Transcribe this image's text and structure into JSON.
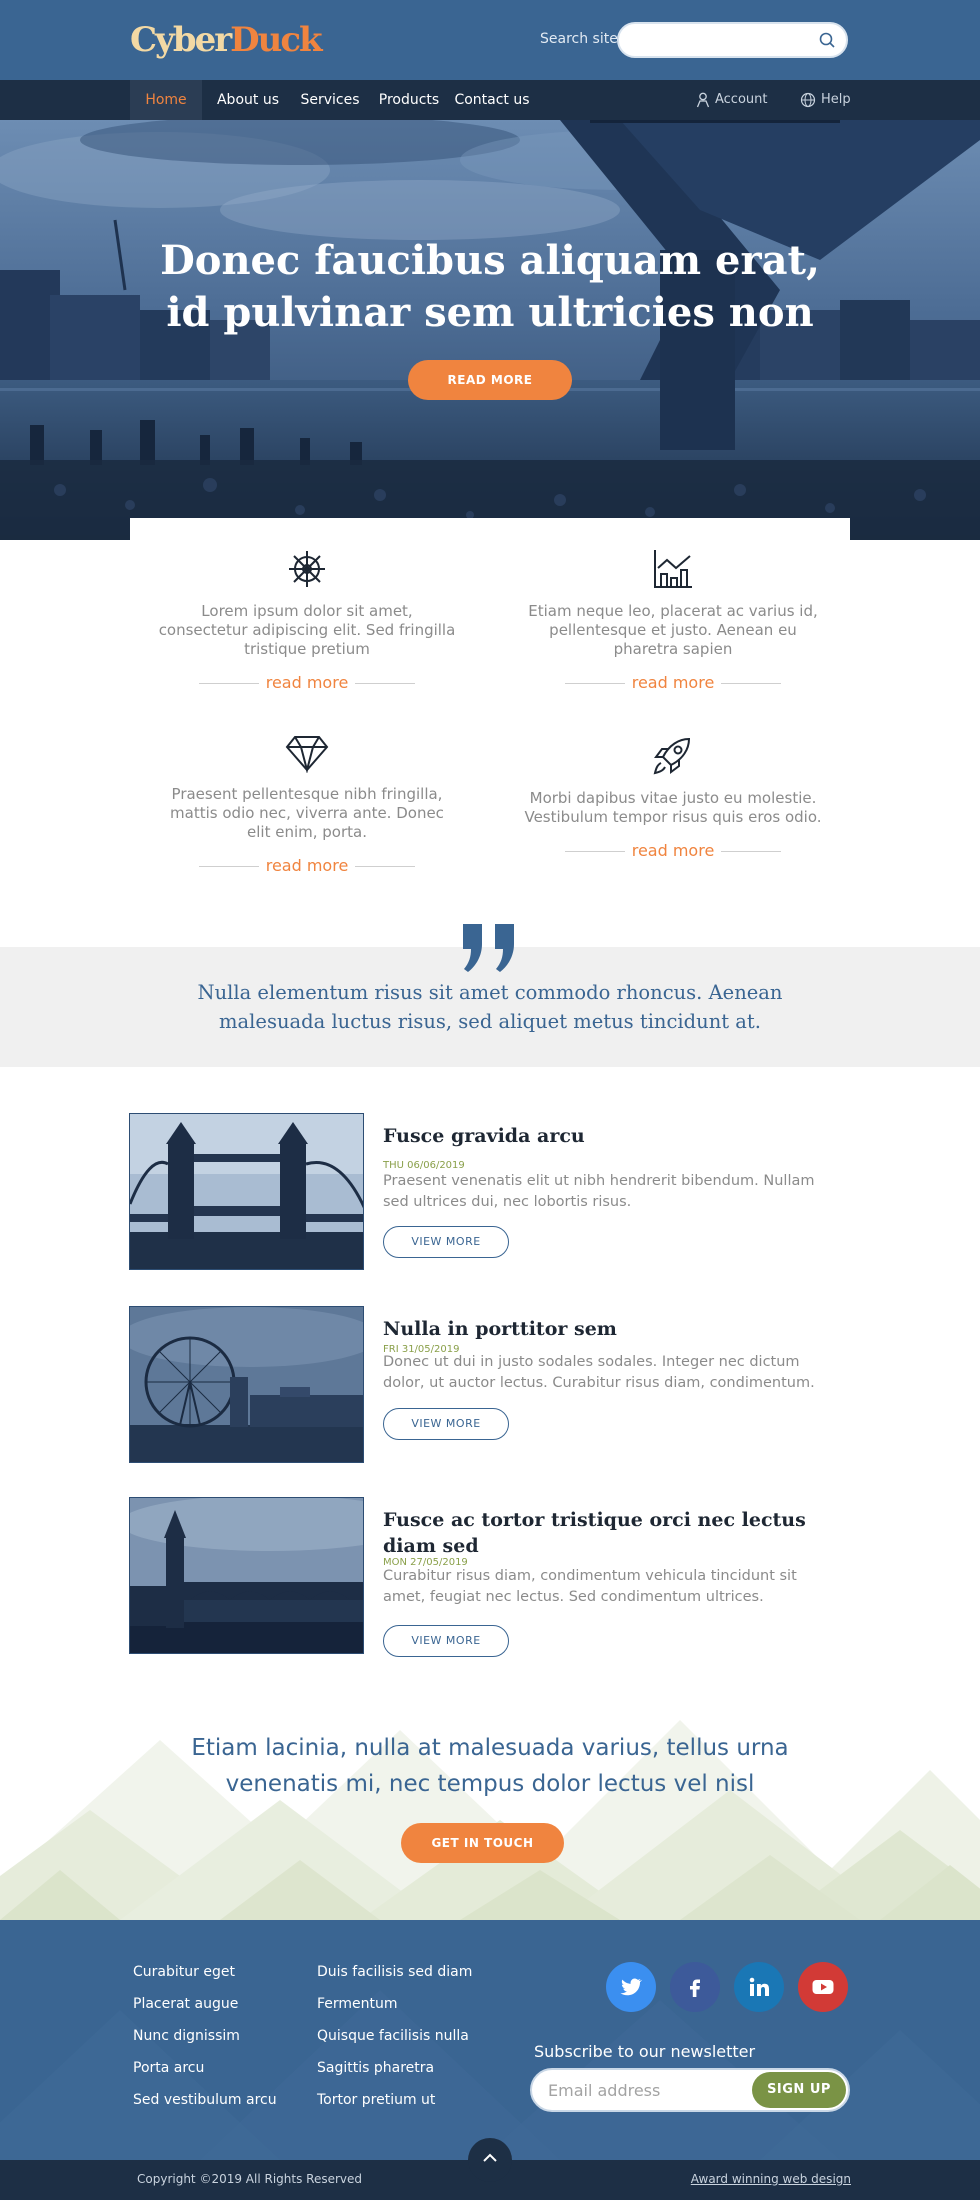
{
  "brand": {
    "logo_part1": "Cyber",
    "logo_part2": "Duck",
    "colors": {
      "primary": "#3a6592",
      "accent": "#f0843f",
      "dark": "#1d2f45",
      "green": "#7a9345"
    }
  },
  "search": {
    "label": "Search site",
    "placeholder": "",
    "icon": "search-icon"
  },
  "nav": {
    "items": [
      {
        "label": "Home",
        "active": true
      },
      {
        "label": "About us"
      },
      {
        "label": "Services"
      },
      {
        "label": "Products"
      },
      {
        "label": "Contact us"
      }
    ],
    "account_label": "Account",
    "help_label": "Help"
  },
  "hero": {
    "title_line1": "Donec faucibus aliquam erat,",
    "title_line2": "id pulvinar sem ultricies non",
    "button": "READ MORE"
  },
  "features": [
    {
      "icon": "ship-wheel-icon",
      "text": "Lorem ipsum dolor sit amet, consectetur adipiscing elit. Sed fringilla tristique pretium",
      "link": "read more"
    },
    {
      "icon": "chart-icon",
      "text": "Etiam neque leo, placerat ac varius id, pellentesque et justo. Aenean eu pharetra sapien",
      "link": "read more"
    },
    {
      "icon": "diamond-icon",
      "text": "Praesent pellentesque nibh fringilla, mattis odio nec, viverra ante. Donec elit enim, porta.",
      "link": "read more"
    },
    {
      "icon": "rocket-icon",
      "text": "Morbi dapibus vitae justo eu molestie. Vestibulum tempor risus quis eros odio.",
      "link": "read more"
    }
  ],
  "quote": {
    "text": "Nulla elementum risus sit amet commodo rhoncus. Aenean malesuada luctus risus, sed aliquet metus tincidunt at."
  },
  "articles": [
    {
      "title": "Fusce gravida arcu",
      "date": "THU 06/06/2019",
      "text": "Praesent venenatis elit ut nibh hendrerit bibendum. Nullam sed ultrices dui, nec lobortis risus.",
      "button": "VIEW MORE"
    },
    {
      "title": "Nulla in porttitor sem",
      "date": "FRI 31/05/2019",
      "text": "Donec ut dui in justo sodales sodales. Integer nec dictum dolor, ut auctor lectus. Curabitur risus diam, condimentum.",
      "button": "VIEW MORE"
    },
    {
      "title": "Fusce ac tortor tristique orci nec lectus diam sed",
      "date": "MON 27/05/2019",
      "text": "Curabitur risus diam, condimentum vehicula tincidunt sit amet, feugiat nec lectus. Sed condimentum ultrices.",
      "button": "VIEW MORE"
    }
  ],
  "cta": {
    "text": "Etiam lacinia, nulla at malesuada varius, tellus urna venenatis mi, nec tempus dolor lectus vel nisl",
    "button": "GET IN TOUCH"
  },
  "footer": {
    "col1": [
      "Curabitur eget",
      "Placerat augue",
      "Nunc dignissim",
      "Porta arcu",
      "Sed vestibulum arcu"
    ],
    "col2": [
      "Duis facilisis sed diam",
      "Fermentum",
      "Quisque facilisis nulla",
      "Sagittis pharetra",
      "Tortor pretium ut"
    ],
    "social": [
      {
        "icon": "twitter-icon",
        "color": "#3b8ff0"
      },
      {
        "icon": "facebook-icon",
        "color": "#3d5a9a"
      },
      {
        "icon": "linkedin-icon",
        "color": "#1a77b5"
      },
      {
        "icon": "youtube-icon",
        "color": "#d23a36"
      }
    ],
    "newsletter_label": "Subscribe to our newsletter",
    "email_placeholder": "Email address",
    "signup": "SIGN UP",
    "copyright": "Copyright  ©2019 All Rights Reserved",
    "award": "Award winning web design"
  }
}
